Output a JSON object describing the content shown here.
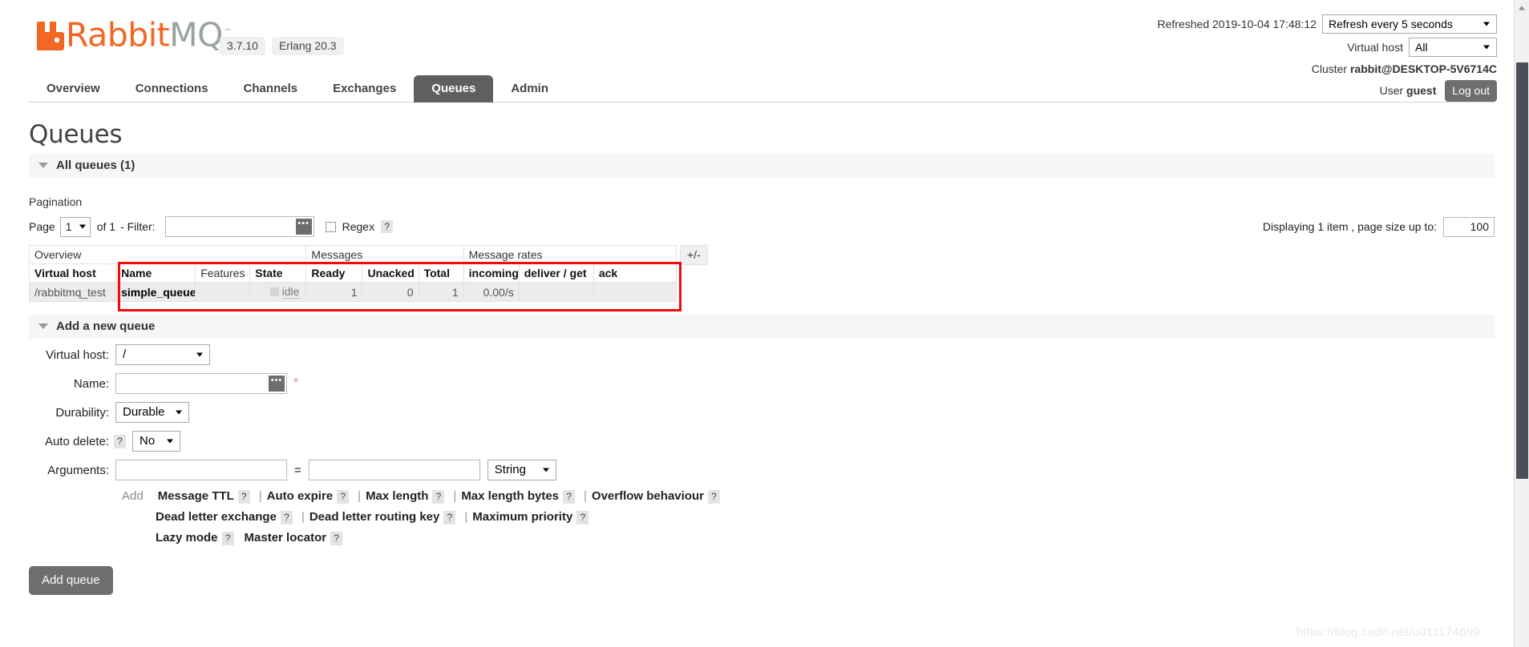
{
  "brand": {
    "name_rabbit": "Rabbit",
    "name_mq": "MQ",
    "tm": "™",
    "version": "3.7.10",
    "erlang": "Erlang 20.3"
  },
  "header": {
    "refreshed_label": "Refreshed 2019-10-04 17:48:12",
    "refresh_select": "Refresh every 5 seconds",
    "vhost_label": "Virtual host",
    "vhost_select": "All",
    "cluster_label": "Cluster",
    "cluster_name": "rabbit@DESKTOP-5V6714C",
    "user_label": "User",
    "user_name": "guest",
    "logout_label": "Log out"
  },
  "nav": {
    "tabs": [
      {
        "label": "Overview",
        "active": false
      },
      {
        "label": "Connections",
        "active": false
      },
      {
        "label": "Channels",
        "active": false
      },
      {
        "label": "Exchanges",
        "active": false
      },
      {
        "label": "Queues",
        "active": true
      },
      {
        "label": "Admin",
        "active": false
      }
    ]
  },
  "page": {
    "title": "Queues",
    "all_queues_header": "All queues (1)",
    "pagination_label": "Pagination"
  },
  "pagination": {
    "page_word": "Page",
    "page_value": "1",
    "of_text": "of 1",
    "filter_label": "- Filter:",
    "filter_value": "",
    "regex_label": "Regex",
    "regex_help": "?",
    "displaying_text": "Displaying 1 item , page size up to:",
    "page_size": "100"
  },
  "queues_table": {
    "group_headers": [
      {
        "label": "Overview",
        "span": 4
      },
      {
        "label": "Messages",
        "span": 3
      },
      {
        "label": "Message rates",
        "span": 3
      }
    ],
    "plus_minus": "+/-",
    "columns": [
      {
        "label": "Virtual host",
        "sortable": true,
        "align": "left"
      },
      {
        "label": "Name",
        "sortable": true,
        "align": "left"
      },
      {
        "label": "Features",
        "sortable": false,
        "align": "left"
      },
      {
        "label": "State",
        "sortable": true,
        "align": "left"
      },
      {
        "label": "Ready",
        "sortable": true,
        "align": "left"
      },
      {
        "label": "Unacked",
        "sortable": true,
        "align": "left"
      },
      {
        "label": "Total",
        "sortable": true,
        "align": "left"
      },
      {
        "label": "incoming",
        "sortable": true,
        "align": "left"
      },
      {
        "label": "deliver / get",
        "sortable": true,
        "align": "left"
      },
      {
        "label": "ack",
        "sortable": true,
        "align": "left"
      }
    ],
    "rows": [
      {
        "vhost": "/rabbitmq_test",
        "name": "simple_queue",
        "features": "",
        "state": "idle",
        "ready": "1",
        "unacked": "0",
        "total": "1",
        "incoming": "0.00/s",
        "deliver_get": "",
        "ack": ""
      }
    ],
    "highlight_color": "#f40a0a"
  },
  "add_queue": {
    "section_title": "Add a new queue",
    "vhost_label": "Virtual host:",
    "vhost_value": "/",
    "name_label": "Name:",
    "name_value": "",
    "name_required_mark": "*",
    "durability_label": "Durability:",
    "durability_value": "Durable",
    "autodelete_label": "Auto delete:",
    "autodelete_help": "?",
    "autodelete_value": "No",
    "arguments_label": "Arguments:",
    "arg_key_value": "",
    "arg_val_value": "",
    "arg_equals": "=",
    "arg_type_value": "String",
    "add_word": "Add",
    "presets_line1": [
      {
        "label": "Message TTL",
        "help": "?"
      },
      {
        "label": "Auto expire",
        "help": "?"
      },
      {
        "label": "Max length",
        "help": "?"
      },
      {
        "label": "Max length bytes",
        "help": "?"
      },
      {
        "label": "Overflow behaviour",
        "help": "?"
      }
    ],
    "presets_line2": [
      {
        "label": "Dead letter exchange",
        "help": "?"
      },
      {
        "label": "Dead letter routing key",
        "help": "?"
      },
      {
        "label": "Maximum priority",
        "help": "?"
      }
    ],
    "presets_line3": [
      {
        "label": "Lazy mode",
        "help": "?"
      },
      {
        "label": "Master locator",
        "help": "?"
      }
    ],
    "separator": "|",
    "submit_label": "Add queue"
  },
  "watermark": "https://blog.csdn.net/u011174699"
}
